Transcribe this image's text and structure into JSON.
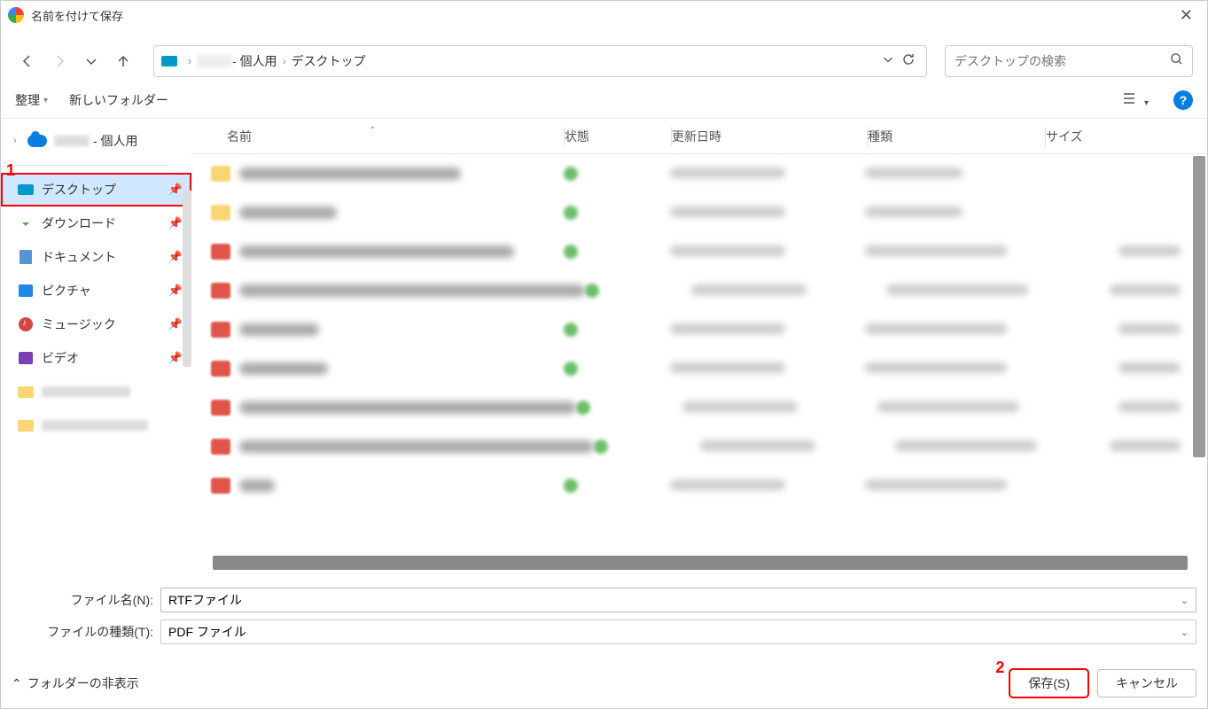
{
  "title": "名前を付けて保存",
  "breadcrumb": {
    "personal": "- 個人用",
    "desktop": "デスクトップ"
  },
  "search": {
    "placeholder": "デスクトップの検索"
  },
  "toolbar": {
    "organize": "整理",
    "newFolder": "新しいフォルダー"
  },
  "sidebar": {
    "personal_suffix": "- 個人用",
    "items": [
      {
        "label": "デスクトップ"
      },
      {
        "label": "ダウンロード"
      },
      {
        "label": "ドキュメント"
      },
      {
        "label": "ピクチャ"
      },
      {
        "label": "ミュージック"
      },
      {
        "label": "ビデオ"
      }
    ]
  },
  "columns": {
    "name": "名前",
    "state": "状態",
    "date": "更新日時",
    "type": "種類",
    "size": "サイズ"
  },
  "file_rows": [
    {
      "icon": "folder",
      "nameW": 250,
      "dateW": 130,
      "typeW": 110,
      "sizeW": 0
    },
    {
      "icon": "folder",
      "nameW": 110,
      "dateW": 130,
      "typeW": 110,
      "sizeW": 0
    },
    {
      "icon": "pdf",
      "nameW": 310,
      "dateW": 130,
      "typeW": 160,
      "sizeW": 70
    },
    {
      "icon": "pdf",
      "nameW": 390,
      "dateW": 130,
      "typeW": 160,
      "sizeW": 80
    },
    {
      "icon": "pdf",
      "nameW": 90,
      "dateW": 130,
      "typeW": 160,
      "sizeW": 70
    },
    {
      "icon": "pdf",
      "nameW": 100,
      "dateW": 130,
      "typeW": 160,
      "sizeW": 70
    },
    {
      "icon": "pdf",
      "nameW": 380,
      "dateW": 130,
      "typeW": 160,
      "sizeW": 70
    },
    {
      "icon": "pdf",
      "nameW": 400,
      "dateW": 130,
      "typeW": 160,
      "sizeW": 80
    },
    {
      "icon": "pdf",
      "nameW": 40,
      "dateW": 130,
      "typeW": 160,
      "sizeW": 0
    }
  ],
  "form": {
    "filename_label": "ファイル名(N):",
    "filename_value": "RTFファイル",
    "filetype_label": "ファイルの種類(T):",
    "filetype_value": "PDF ファイル"
  },
  "footer": {
    "hide_folders": "フォルダーの非表示",
    "save": "保存(S)",
    "cancel": "キャンセル"
  },
  "annotations": {
    "one": "1",
    "two": "2"
  }
}
